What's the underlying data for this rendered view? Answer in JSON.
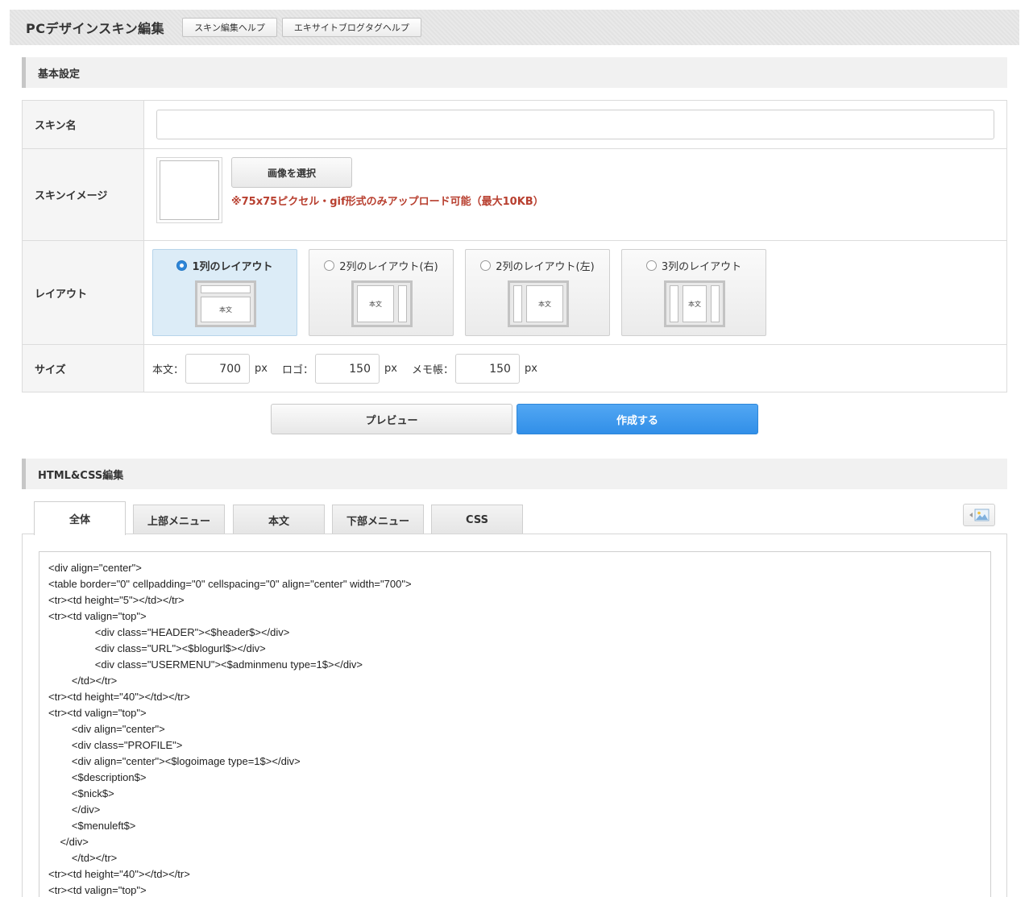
{
  "header": {
    "title": "PCデザインスキン編集",
    "help_buttons": [
      "スキン編集ヘルプ",
      "エキサイトブログタグヘルプ"
    ]
  },
  "basic": {
    "section_title": "基本設定",
    "skin_name_label": "スキン名",
    "skin_name_value": "",
    "skin_image_label": "スキンイメージ",
    "select_image_button": "画像を選択",
    "image_note": "※75x75ピクセル・gif形式のみアップロード可能（最大10KB）",
    "layout_label": "レイアウト",
    "layouts": [
      {
        "label": "1列のレイアウト",
        "selected": true,
        "body_text": "本文"
      },
      {
        "label": "2列のレイアウト(右)",
        "selected": false,
        "body_text": "本文"
      },
      {
        "label": "2列のレイアウト(左)",
        "selected": false,
        "body_text": "本文"
      },
      {
        "label": "3列のレイアウト",
        "selected": false,
        "body_text": "本文"
      }
    ],
    "size_label": "サイズ",
    "sizes": [
      {
        "label": "本文：",
        "value": "700",
        "unit": "px"
      },
      {
        "label": "ロゴ：",
        "value": "150",
        "unit": "px"
      },
      {
        "label": "メモ帳：",
        "value": "150",
        "unit": "px"
      }
    ]
  },
  "actions": {
    "preview": "プレビュー",
    "create": "作成する"
  },
  "editor": {
    "section_title": "HTML&CSS編集",
    "tabs": [
      "全体",
      "上部メニュー",
      "本文",
      "下部メニュー",
      "CSS"
    ],
    "active_tab": "全体",
    "code_lines": [
      "<div align=\"center\">",
      "<table border=\"0\" cellpadding=\"0\" cellspacing=\"0\" align=\"center\" width=\"700\">",
      "<tr><td height=\"5\"></td></tr>",
      "<tr><td valign=\"top\">",
      "                <div class=\"HEADER\"><$header$></div>",
      "                <div class=\"URL\"><$blogurl$></div>",
      "                <div class=\"USERMENU\"><$adminmenu type=1$></div>",
      "        </td></tr>",
      "<tr><td height=\"40\"></td></tr>",
      "<tr><td valign=\"top\">",
      "        <div align=\"center\">",
      "        <div class=\"PROFILE\">",
      "        <div align=\"center\"><$logoimage type=1$></div>",
      "        <$description$>",
      "        <$nick$>",
      "        </div>",
      "        <$menuleft$>",
      "    </div>",
      "        </td></tr>",
      "<tr><td height=\"40\"></td></tr>",
      "<tr><td valign=\"top\">"
    ]
  },
  "colors": {
    "accent_blue": "#3a95ec",
    "note_red": "#b83f2f",
    "selected_layout_bg": "#dcecf7"
  }
}
